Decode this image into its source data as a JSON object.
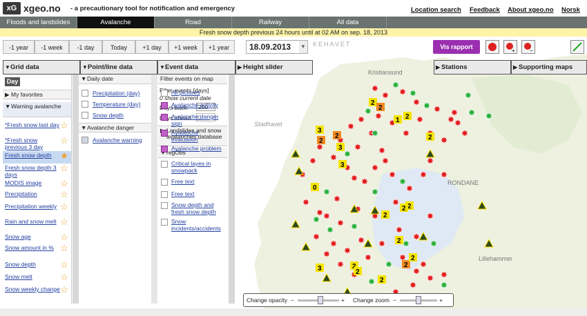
{
  "header": {
    "logo_text": "xG",
    "brand": "xgeo.no",
    "tagline": "- a precautionary tool for notification and emergency",
    "links": [
      "Location search",
      "Feedback",
      "About xgeo.no",
      "Norsk"
    ]
  },
  "tabs": [
    {
      "label": "Floods and landslides",
      "active": false
    },
    {
      "label": "Avalanche",
      "active": true
    },
    {
      "label": "Road",
      "active": false
    },
    {
      "label": "Railway",
      "active": false
    },
    {
      "label": "All data",
      "active": false
    }
  ],
  "info_bar": "Fresh snow depth previous 24 hours until at 02 AM  on sep. 18, 2013",
  "date_buttons": [
    "-1 year",
    "-1 week",
    "-1 day",
    "Today",
    "+1 day",
    "+1 week",
    "+1 year"
  ],
  "date_value": "18.09.2013",
  "vis_rapport": "Vis rapport",
  "sections": {
    "grid": "Grid data",
    "point": "Point/line data",
    "event": "Event data",
    "height": "Height slider",
    "stations": "Stations",
    "support": "Supporting maps"
  },
  "grid_panel": {
    "day": "Day",
    "favorites": "My favorites",
    "warning": "Warning avalanche",
    "layers": [
      "*Fresh snow last day",
      "*Fresh snow previous 3 day",
      "Fresh snow depth",
      "Fresh snow depth 3 days",
      "MODIS image",
      "Precipitation",
      "Precipitation weekly",
      "Rain and snow melt",
      "Snow age",
      "Snow amount in %",
      "Snow depth",
      "Snow melt",
      "Snow weekly change"
    ],
    "selected_index": 2
  },
  "point_panel": {
    "daily": "Daily date",
    "items": [
      "Precipitation (day)",
      "Temperature (day)",
      "Snow depth"
    ],
    "danger": "Avalanche danger",
    "danger_item": "Avalanche warning"
  },
  "event_panel": {
    "filter_btn": "Filter events on map",
    "filter_title": "Filter events [days]",
    "filter_note": "0 show current date",
    "days_back_label": "Days back:",
    "days_back_value": "200",
    "days_ahead_label": "Days ahead",
    "days_ahead_value": "0",
    "landslides": "Landslides and snow avalanches database",
    "regobs": "regObs",
    "items": [
      {
        "label": "All pictures",
        "checked": false
      },
      {
        "label": "Avalanche activity",
        "checked": true
      },
      {
        "label": "Avalanche danger sign",
        "checked": true
      },
      {
        "label": "Avalanche evaluation",
        "checked": true
      },
      {
        "label": "Avalanche problem",
        "checked": true
      },
      {
        "label": "Critical layes in snowpack",
        "checked": false
      },
      {
        "label": "Free text",
        "checked": false
      },
      {
        "label": "Free text",
        "checked": false
      },
      {
        "label": "Snow depth and fresh snow depth",
        "checked": false
      },
      {
        "label": "Snow incidents/accidents",
        "checked": false
      }
    ]
  },
  "map": {
    "place_labels": [
      "Kristiansund",
      "Stadhavet",
      "KEHAVET",
      "RONDANE",
      "Lillehammer"
    ],
    "marker_numbers": [
      "2",
      "2",
      "3",
      "2",
      "1",
      "2",
      "3",
      "2",
      "2",
      "2",
      "2",
      "2",
      "2",
      "2",
      "2",
      "3",
      "2",
      "3",
      "2",
      "2",
      "2",
      "0"
    ],
    "colors": {
      "land": "#eef1df",
      "sea": "#ffffff",
      "glacier": "#dfe8f5",
      "burst_red": "#e21b1b",
      "burst_green": "#27b03a",
      "square_yellow": "#f4e400",
      "square_orange": "#f08a22"
    }
  },
  "opacity": {
    "label": "Change opacity",
    "zoom_label": "Change zoom",
    "minus": "−",
    "plus": "+",
    "opacity_level": 0.55,
    "zoom_level": 0.5
  }
}
